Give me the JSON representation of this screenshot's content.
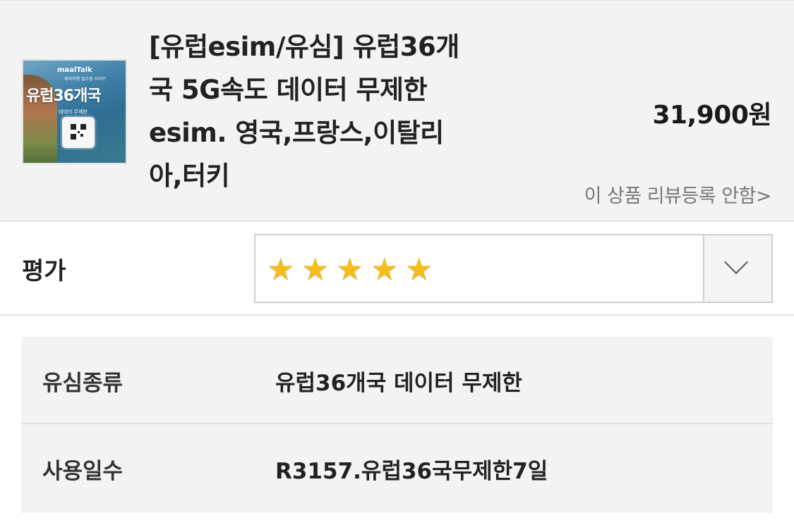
{
  "product": {
    "thumbnail": {
      "brand": "maalTalk",
      "brand_sub": "해외여행 필수템 사이트",
      "title": "유럽36개국",
      "subtitle": "데이터 무제한"
    },
    "title": "[유럽esim/유심] 유럽36개국 5G속도 데이터 무제한 esim. 영국,프랑스,이탈리아,터키",
    "price": "31,900원",
    "review_link": "이 상품 리뷰등록 안함>"
  },
  "rating": {
    "label": "평가",
    "stars": [
      "★",
      "★",
      "★",
      "★",
      "★"
    ],
    "value": 5,
    "max": 5,
    "star_color": "#f4bd1a"
  },
  "options": [
    {
      "key": "유심종류",
      "value": "유럽36개국 데이터 무제한"
    },
    {
      "key": "사용일수",
      "value": "R3157.유럽36국무제한7일"
    }
  ]
}
